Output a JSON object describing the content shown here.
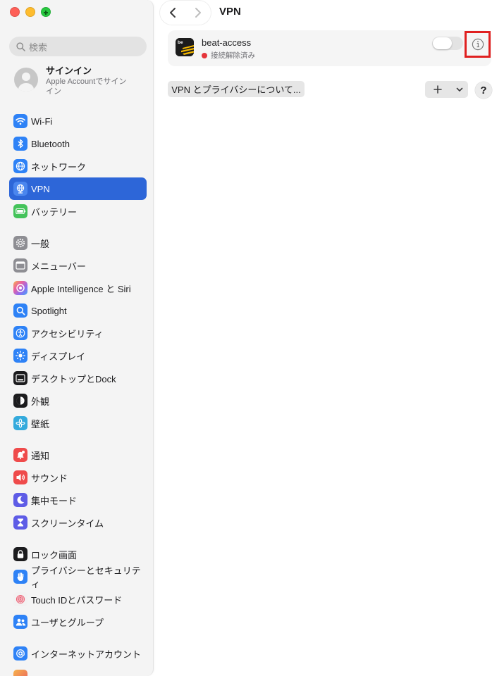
{
  "search": {
    "placeholder": "検索"
  },
  "account": {
    "title": "サインイン",
    "subtitle_line1": "Apple Accountでサイン",
    "subtitle_line2": "イン"
  },
  "sidebar": {
    "items": [
      {
        "label": "Wi-Fi",
        "icon": "wifi-icon",
        "color": "#2e82f6"
      },
      {
        "label": "Bluetooth",
        "icon": "bluetooth-icon",
        "color": "#2e82f6"
      },
      {
        "label": "ネットワーク",
        "icon": "globe-icon",
        "color": "#2e82f6"
      },
      {
        "label": "VPN",
        "icon": "vpn-globe-icon",
        "color": "#2e82f6",
        "active": true
      },
      {
        "label": "バッテリー",
        "icon": "battery-icon",
        "color": "#44c35a"
      },
      {
        "label": "一般",
        "icon": "gear-icon",
        "color": "#8e8e93"
      },
      {
        "label": "メニューバー",
        "icon": "menubar-icon",
        "color": "#8e8e93"
      },
      {
        "label": "Apple Intelligence と Siri",
        "icon": "apple-intelligence-icon",
        "color": "#f08a4b"
      },
      {
        "label": "Spotlight",
        "icon": "spotlight-icon",
        "color": "#2e82f6"
      },
      {
        "label": "アクセシビリティ",
        "icon": "accessibility-icon",
        "color": "#2e82f6"
      },
      {
        "label": "ディスプレイ",
        "icon": "display-icon",
        "color": "#2e82f6"
      },
      {
        "label": "デスクトップとDock",
        "icon": "dock-icon",
        "color": "#1c1c1e"
      },
      {
        "label": "外観",
        "icon": "appearance-icon",
        "color": "#1c1c1e"
      },
      {
        "label": "壁紙",
        "icon": "wallpaper-icon",
        "color": "#34aadc"
      },
      {
        "label": "通知",
        "icon": "notifications-icon",
        "color": "#ef4b4b"
      },
      {
        "label": "サウンド",
        "icon": "sound-icon",
        "color": "#ef4b4b"
      },
      {
        "label": "集中モード",
        "icon": "focus-moon-icon",
        "color": "#5e5ce6"
      },
      {
        "label": "スクリーンタイム",
        "icon": "hourglass-icon",
        "color": "#5e5ce6"
      },
      {
        "label": "ロック画面",
        "icon": "lock-icon",
        "color": "#1c1c1e"
      },
      {
        "label": "プライバシーとセキュリティ",
        "icon": "hand-icon",
        "color": "#2e82f6"
      },
      {
        "label": "Touch IDとパスワード",
        "icon": "fingerprint-icon",
        "color": "#f2f2f2"
      },
      {
        "label": "ユーザとグループ",
        "icon": "users-icon",
        "color": "#2e82f6"
      },
      {
        "label": "インターネットアカウント",
        "icon": "at-icon",
        "color": "#2e82f6"
      }
    ]
  },
  "header": {
    "title": "VPN"
  },
  "vpn": {
    "name": "beat-access",
    "status": "接続解除済み",
    "status_color": "#e5343a",
    "icon_text": "be"
  },
  "buttons": {
    "about": "VPN とプライバシーについて...",
    "help": "?"
  },
  "colors": {
    "accent": "#2d66d8",
    "highlight_box": "#e02020"
  }
}
